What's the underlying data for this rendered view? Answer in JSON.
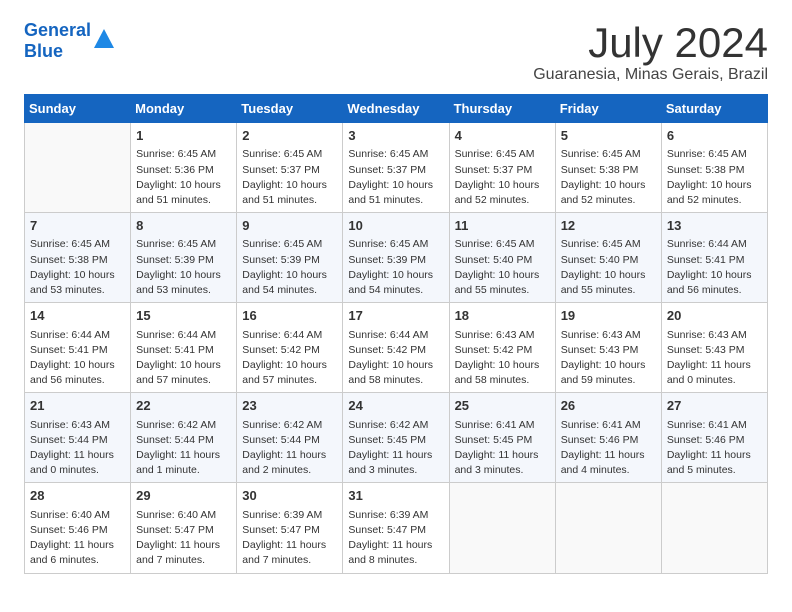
{
  "header": {
    "logo_line1": "General",
    "logo_line2": "Blue",
    "month_year": "July 2024",
    "location": "Guaranesia, Minas Gerais, Brazil"
  },
  "weekdays": [
    "Sunday",
    "Monday",
    "Tuesday",
    "Wednesday",
    "Thursday",
    "Friday",
    "Saturday"
  ],
  "weeks": [
    [
      {
        "day": "",
        "sunrise": "",
        "sunset": "",
        "daylight": ""
      },
      {
        "day": "1",
        "sunrise": "Sunrise: 6:45 AM",
        "sunset": "Sunset: 5:36 PM",
        "daylight": "Daylight: 10 hours and 51 minutes."
      },
      {
        "day": "2",
        "sunrise": "Sunrise: 6:45 AM",
        "sunset": "Sunset: 5:37 PM",
        "daylight": "Daylight: 10 hours and 51 minutes."
      },
      {
        "day": "3",
        "sunrise": "Sunrise: 6:45 AM",
        "sunset": "Sunset: 5:37 PM",
        "daylight": "Daylight: 10 hours and 51 minutes."
      },
      {
        "day": "4",
        "sunrise": "Sunrise: 6:45 AM",
        "sunset": "Sunset: 5:37 PM",
        "daylight": "Daylight: 10 hours and 52 minutes."
      },
      {
        "day": "5",
        "sunrise": "Sunrise: 6:45 AM",
        "sunset": "Sunset: 5:38 PM",
        "daylight": "Daylight: 10 hours and 52 minutes."
      },
      {
        "day": "6",
        "sunrise": "Sunrise: 6:45 AM",
        "sunset": "Sunset: 5:38 PM",
        "daylight": "Daylight: 10 hours and 52 minutes."
      }
    ],
    [
      {
        "day": "7",
        "sunrise": "Sunrise: 6:45 AM",
        "sunset": "Sunset: 5:38 PM",
        "daylight": "Daylight: 10 hours and 53 minutes."
      },
      {
        "day": "8",
        "sunrise": "Sunrise: 6:45 AM",
        "sunset": "Sunset: 5:39 PM",
        "daylight": "Daylight: 10 hours and 53 minutes."
      },
      {
        "day": "9",
        "sunrise": "Sunrise: 6:45 AM",
        "sunset": "Sunset: 5:39 PM",
        "daylight": "Daylight: 10 hours and 54 minutes."
      },
      {
        "day": "10",
        "sunrise": "Sunrise: 6:45 AM",
        "sunset": "Sunset: 5:39 PM",
        "daylight": "Daylight: 10 hours and 54 minutes."
      },
      {
        "day": "11",
        "sunrise": "Sunrise: 6:45 AM",
        "sunset": "Sunset: 5:40 PM",
        "daylight": "Daylight: 10 hours and 55 minutes."
      },
      {
        "day": "12",
        "sunrise": "Sunrise: 6:45 AM",
        "sunset": "Sunset: 5:40 PM",
        "daylight": "Daylight: 10 hours and 55 minutes."
      },
      {
        "day": "13",
        "sunrise": "Sunrise: 6:44 AM",
        "sunset": "Sunset: 5:41 PM",
        "daylight": "Daylight: 10 hours and 56 minutes."
      }
    ],
    [
      {
        "day": "14",
        "sunrise": "Sunrise: 6:44 AM",
        "sunset": "Sunset: 5:41 PM",
        "daylight": "Daylight: 10 hours and 56 minutes."
      },
      {
        "day": "15",
        "sunrise": "Sunrise: 6:44 AM",
        "sunset": "Sunset: 5:41 PM",
        "daylight": "Daylight: 10 hours and 57 minutes."
      },
      {
        "day": "16",
        "sunrise": "Sunrise: 6:44 AM",
        "sunset": "Sunset: 5:42 PM",
        "daylight": "Daylight: 10 hours and 57 minutes."
      },
      {
        "day": "17",
        "sunrise": "Sunrise: 6:44 AM",
        "sunset": "Sunset: 5:42 PM",
        "daylight": "Daylight: 10 hours and 58 minutes."
      },
      {
        "day": "18",
        "sunrise": "Sunrise: 6:43 AM",
        "sunset": "Sunset: 5:42 PM",
        "daylight": "Daylight: 10 hours and 58 minutes."
      },
      {
        "day": "19",
        "sunrise": "Sunrise: 6:43 AM",
        "sunset": "Sunset: 5:43 PM",
        "daylight": "Daylight: 10 hours and 59 minutes."
      },
      {
        "day": "20",
        "sunrise": "Sunrise: 6:43 AM",
        "sunset": "Sunset: 5:43 PM",
        "daylight": "Daylight: 11 hours and 0 minutes."
      }
    ],
    [
      {
        "day": "21",
        "sunrise": "Sunrise: 6:43 AM",
        "sunset": "Sunset: 5:44 PM",
        "daylight": "Daylight: 11 hours and 0 minutes."
      },
      {
        "day": "22",
        "sunrise": "Sunrise: 6:42 AM",
        "sunset": "Sunset: 5:44 PM",
        "daylight": "Daylight: 11 hours and 1 minute."
      },
      {
        "day": "23",
        "sunrise": "Sunrise: 6:42 AM",
        "sunset": "Sunset: 5:44 PM",
        "daylight": "Daylight: 11 hours and 2 minutes."
      },
      {
        "day": "24",
        "sunrise": "Sunrise: 6:42 AM",
        "sunset": "Sunset: 5:45 PM",
        "daylight": "Daylight: 11 hours and 3 minutes."
      },
      {
        "day": "25",
        "sunrise": "Sunrise: 6:41 AM",
        "sunset": "Sunset: 5:45 PM",
        "daylight": "Daylight: 11 hours and 3 minutes."
      },
      {
        "day": "26",
        "sunrise": "Sunrise: 6:41 AM",
        "sunset": "Sunset: 5:46 PM",
        "daylight": "Daylight: 11 hours and 4 minutes."
      },
      {
        "day": "27",
        "sunrise": "Sunrise: 6:41 AM",
        "sunset": "Sunset: 5:46 PM",
        "daylight": "Daylight: 11 hours and 5 minutes."
      }
    ],
    [
      {
        "day": "28",
        "sunrise": "Sunrise: 6:40 AM",
        "sunset": "Sunset: 5:46 PM",
        "daylight": "Daylight: 11 hours and 6 minutes."
      },
      {
        "day": "29",
        "sunrise": "Sunrise: 6:40 AM",
        "sunset": "Sunset: 5:47 PM",
        "daylight": "Daylight: 11 hours and 7 minutes."
      },
      {
        "day": "30",
        "sunrise": "Sunrise: 6:39 AM",
        "sunset": "Sunset: 5:47 PM",
        "daylight": "Daylight: 11 hours and 7 minutes."
      },
      {
        "day": "31",
        "sunrise": "Sunrise: 6:39 AM",
        "sunset": "Sunset: 5:47 PM",
        "daylight": "Daylight: 11 hours and 8 minutes."
      },
      {
        "day": "",
        "sunrise": "",
        "sunset": "",
        "daylight": ""
      },
      {
        "day": "",
        "sunrise": "",
        "sunset": "",
        "daylight": ""
      },
      {
        "day": "",
        "sunrise": "",
        "sunset": "",
        "daylight": ""
      }
    ]
  ]
}
